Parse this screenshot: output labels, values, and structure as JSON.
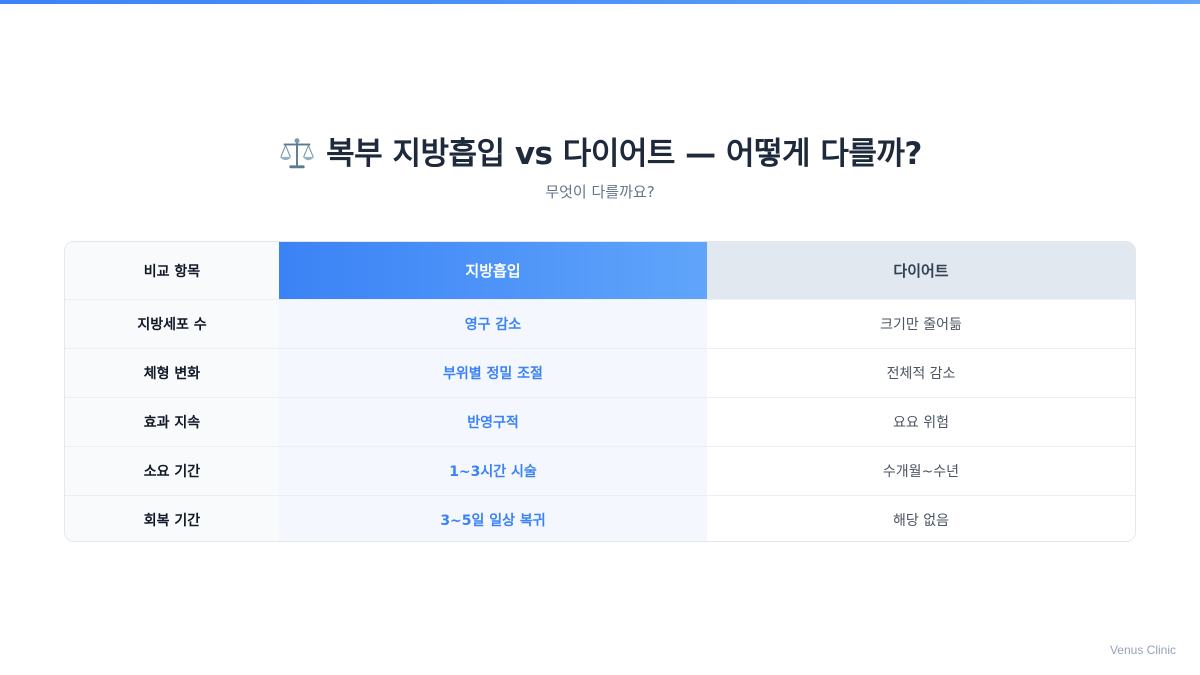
{
  "slide": {
    "title": "복부 지방흡입 vs 다이어트 — 어떻게 다를까?",
    "title_icon": "balance-scale-icon",
    "subtitle": "무엇이 다를까요?",
    "brand": "Venus Clinic",
    "accent_color": "#3b82f6"
  },
  "table": {
    "headers": [
      "비교 항목",
      "지방흡입",
      "다이어트"
    ],
    "rows": [
      [
        "지방세포 수",
        "영구 감소",
        "크기만 줄어듦"
      ],
      [
        "체형 변화",
        "부위별 정밀 조절",
        "전체적 감소"
      ],
      [
        "효과 지속",
        "반영구적",
        "요요 위험"
      ],
      [
        "소요 기간",
        "1~3시간 시술",
        "수개월~수년"
      ],
      [
        "회복 기간",
        "3~5일 일상 복귀",
        "해당 없음"
      ]
    ]
  }
}
